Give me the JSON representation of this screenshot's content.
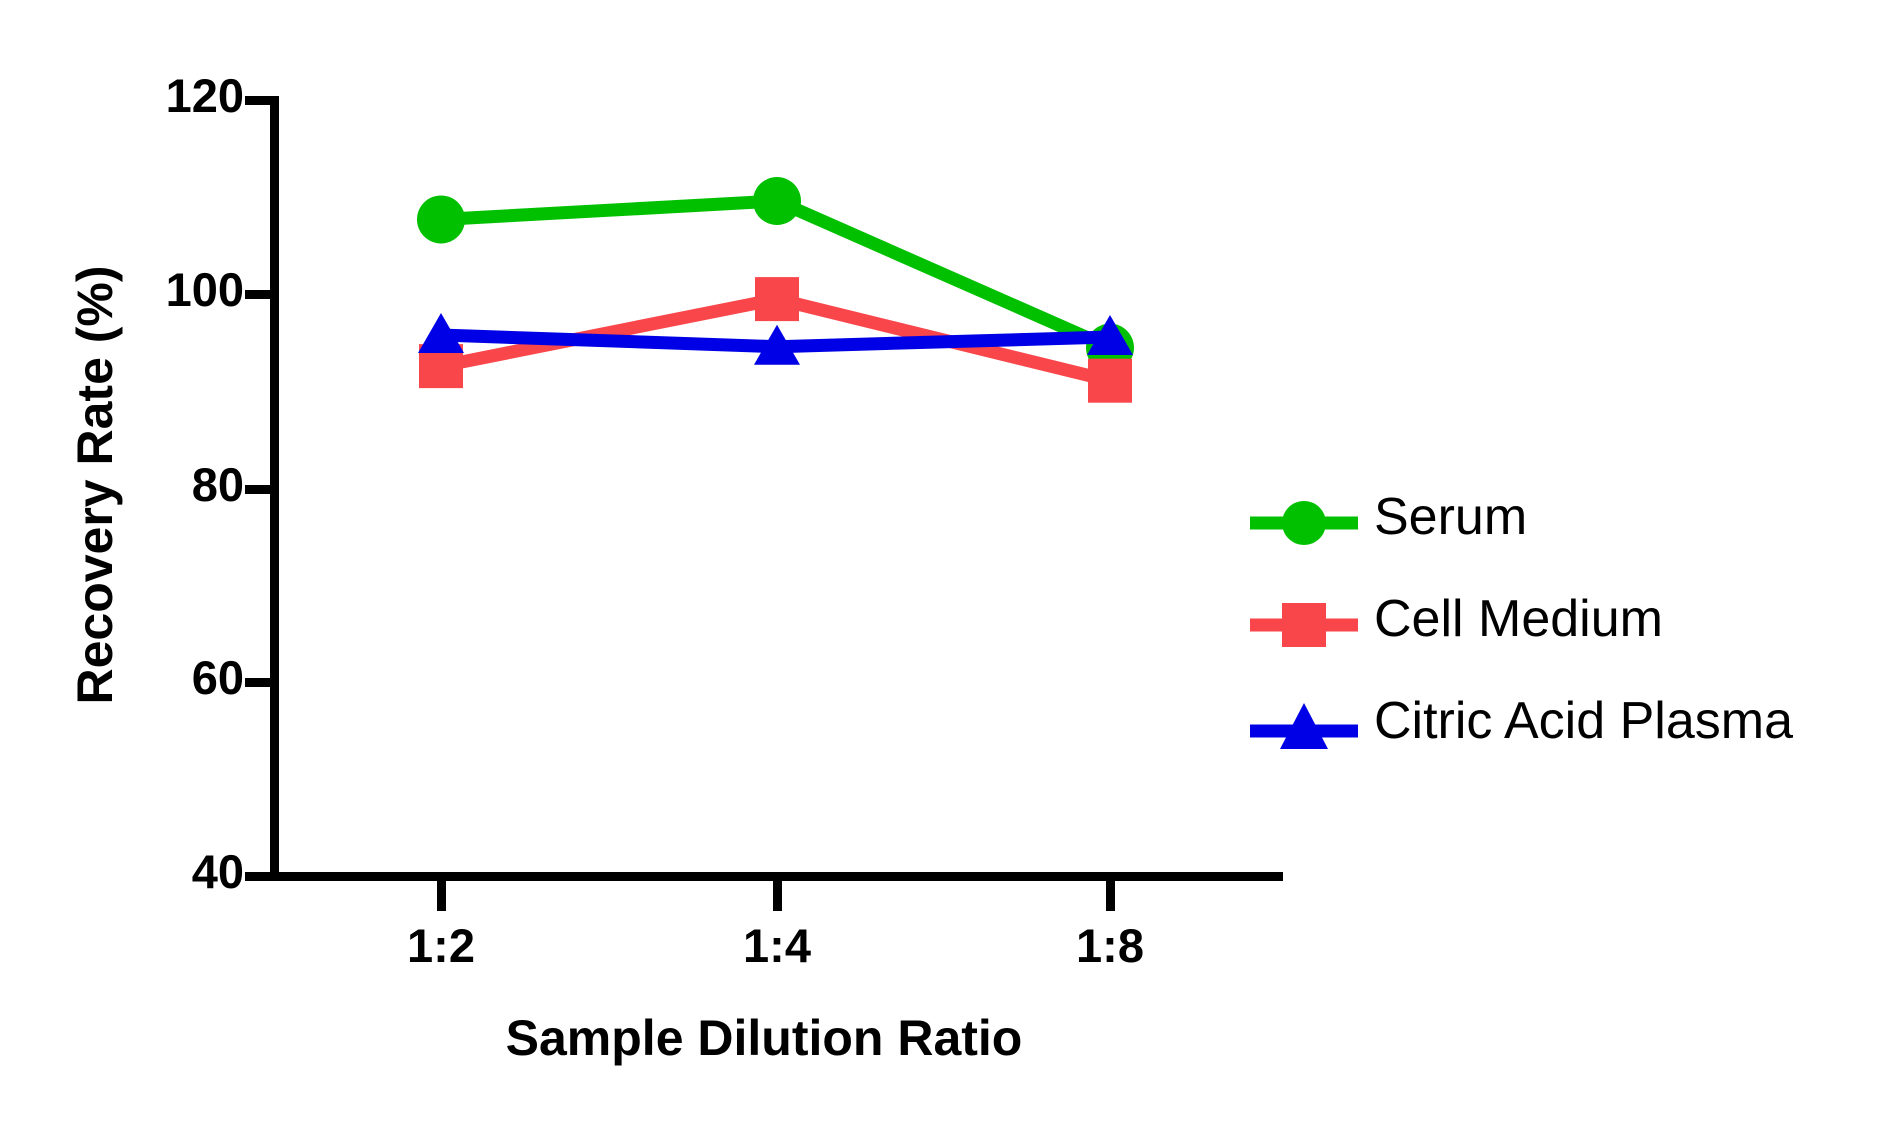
{
  "chart_data": {
    "type": "line",
    "title": "",
    "xlabel": "Sample Dilution Ratio",
    "ylabel": "Recovery Rate (%)",
    "categories": [
      "1:2",
      "1:4",
      "1:8"
    ],
    "ylim": [
      40,
      120
    ],
    "yticks": [
      40,
      60,
      80,
      100,
      120
    ],
    "ytick_labels": [
      "40",
      "60",
      "80",
      "100",
      "120"
    ],
    "grid": false,
    "legend_position": "right",
    "series": [
      {
        "name": "Serum",
        "color": "#00C000",
        "marker": "circle",
        "values": [
          107.7,
          109.6,
          94.5
        ]
      },
      {
        "name": "Cell Medium",
        "color": "#F9464B",
        "marker": "square",
        "values": [
          92.6,
          99.5,
          91.1
        ]
      },
      {
        "name": "Citric Acid Plasma",
        "color": "#0000E6",
        "marker": "triangle",
        "values": [
          95.8,
          94.6,
          95.6
        ]
      }
    ]
  },
  "axes": {
    "y_title": "Recovery Rate (%)",
    "x_title": "Sample Dilution Ratio",
    "y_tick_labels": [
      "120",
      "100",
      "80",
      "60",
      "40"
    ],
    "x_tick_labels": [
      "1:2",
      "1:4",
      "1:8"
    ],
    "axis_color": "#000000"
  },
  "legend": {
    "items": [
      {
        "label": "Serum",
        "color": "#00C000",
        "marker": "circle-marker"
      },
      {
        "label": "Cell Medium",
        "color": "#F9464B",
        "marker": "square-marker"
      },
      {
        "label": "Citric Acid Plasma",
        "color": "#0000E6",
        "marker": "triangle-marker"
      }
    ]
  }
}
